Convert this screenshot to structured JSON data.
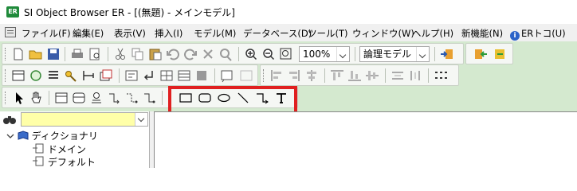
{
  "window": {
    "title": "SI Object Browser ER - [(無題) - メインモデル]",
    "app_icon_text": "ER"
  },
  "menu": [
    {
      "label": "ファイル(F)"
    },
    {
      "label": "編集(E)"
    },
    {
      "label": "表示(V)"
    },
    {
      "label": "挿入(I)"
    },
    {
      "label": "モデル(M)"
    },
    {
      "label": "データベース(D)"
    },
    {
      "label": "ツール(T)"
    },
    {
      "label": "ウィンドウ(W)"
    },
    {
      "label": "ヘルプ(H)"
    },
    {
      "label": "新機能(N)"
    },
    {
      "label": "ERトコ(U)"
    }
  ],
  "toolbar": {
    "zoom_value": "100%",
    "model_view_value": "論理モデル"
  },
  "left_panel": {
    "search_value": "",
    "tree": [
      {
        "label": "ディクショナリ"
      },
      {
        "label": "ドメイン"
      },
      {
        "label": "デフォルト"
      }
    ]
  },
  "icons": {
    "draw_tools": [
      "rectangle-icon",
      "rounded-rectangle-icon",
      "ellipse-icon",
      "line-icon",
      "elbow-connector-icon",
      "text-icon"
    ]
  },
  "colors": {
    "toolbar_bg": "#d4e9cf",
    "highlight": "#e02020",
    "search_bg": "#ffffa8"
  }
}
